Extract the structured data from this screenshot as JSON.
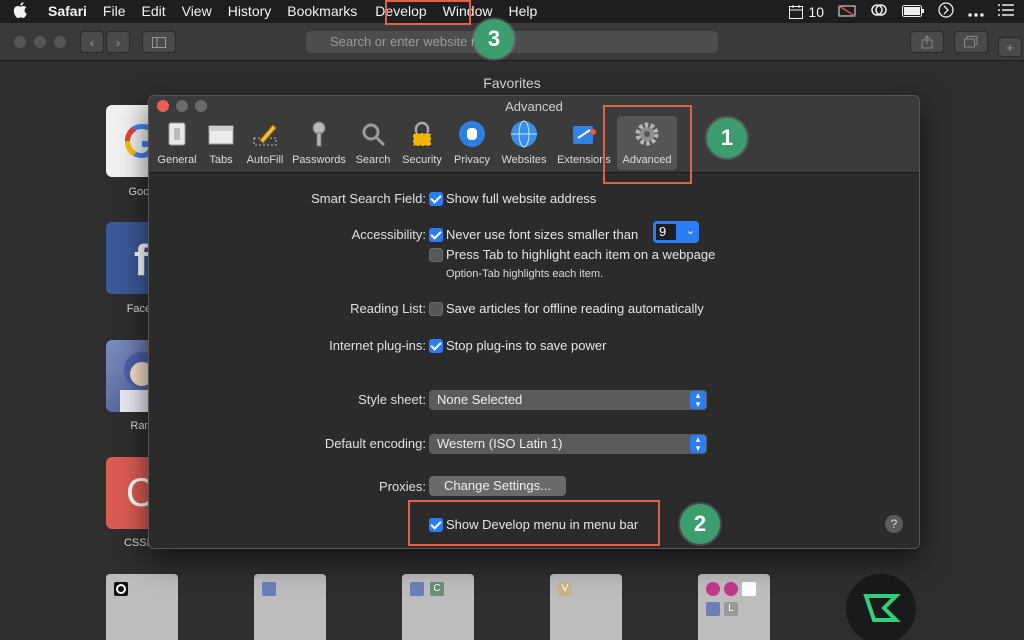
{
  "menubar": {
    "app_name": "Safari",
    "items": [
      "File",
      "Edit",
      "View",
      "History",
      "Bookmarks",
      "Develop",
      "Window",
      "Help"
    ],
    "status": {
      "calendar_day": "10"
    }
  },
  "browser": {
    "url_placeholder": "Search or enter website name",
    "favorites_title": "Favorites",
    "favorites": [
      {
        "label": "Goog",
        "color": "#f2f2f2"
      },
      {
        "label": "Faceb",
        "color": "#3b5998"
      },
      {
        "label": "Ram",
        "color": "#5d6f9c"
      },
      {
        "label": "CSSBa",
        "color": "#d95b52"
      }
    ],
    "bottom_tiles": [
      {
        "letter": ""
      },
      {
        "letter": ""
      },
      {
        "letter": "C"
      },
      {
        "letter": "V"
      },
      {
        "letter": "L"
      }
    ]
  },
  "dialog": {
    "title": "Advanced",
    "tabs": [
      {
        "label": "General",
        "icon": "switch-icon"
      },
      {
        "label": "Tabs",
        "icon": "tabs-icon"
      },
      {
        "label": "AutoFill",
        "icon": "pencil-icon"
      },
      {
        "label": "Passwords",
        "icon": "key-icon"
      },
      {
        "label": "Search",
        "icon": "magnifier-icon"
      },
      {
        "label": "Security",
        "icon": "lock-icon"
      },
      {
        "label": "Privacy",
        "icon": "hand-icon"
      },
      {
        "label": "Websites",
        "icon": "globe-icon"
      },
      {
        "label": "Extensions",
        "icon": "puzzle-icon"
      },
      {
        "label": "Advanced",
        "icon": "gear-icon"
      }
    ],
    "selected_tab": "Advanced",
    "smart_search": {
      "label": "Smart Search Field:",
      "option": "Show full website address",
      "checked": true
    },
    "accessibility": {
      "label": "Accessibility:",
      "option1": "Never use font sizes smaller than",
      "option1_checked": true,
      "font_size": "9",
      "option2": "Press Tab to highlight each item on a webpage",
      "option2_checked": false,
      "note": "Option-Tab highlights each item."
    },
    "reading_list": {
      "label": "Reading List:",
      "option": "Save articles for offline reading automatically",
      "checked": false
    },
    "plugins": {
      "label": "Internet plug-ins:",
      "option": "Stop plug-ins to save power",
      "checked": true
    },
    "style_sheet": {
      "label": "Style sheet:",
      "value": "None Selected"
    },
    "encoding": {
      "label": "Default encoding:",
      "value": "Western (ISO Latin 1)"
    },
    "proxies": {
      "label": "Proxies:",
      "button": "Change Settings..."
    },
    "develop_menu": {
      "option": "Show Develop menu in menu bar",
      "checked": true
    },
    "help": "?"
  },
  "callouts": {
    "step1": "1",
    "step2": "2",
    "step3": "3"
  },
  "colors": {
    "accent": "#2c7cf6",
    "callout_box": "#e0604a",
    "badge": "#3c9e6f"
  }
}
